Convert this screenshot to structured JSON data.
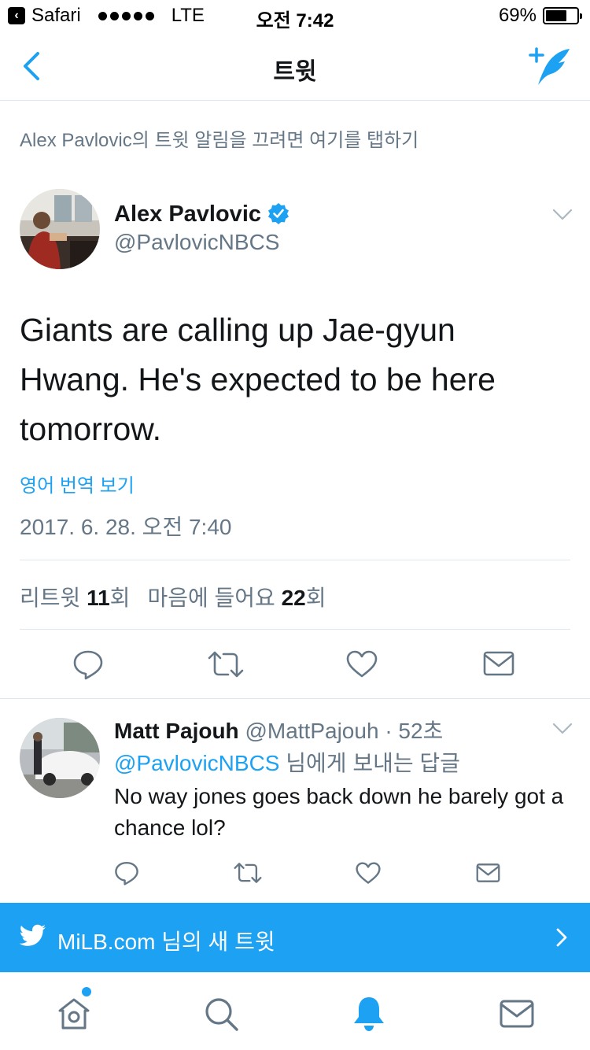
{
  "status_bar": {
    "back_app": "Safari",
    "carrier": "LTE",
    "time": "오전 7:42",
    "battery": "69%",
    "battery_level": 0.69
  },
  "nav": {
    "title": "트윗",
    "back_icon": "chevron-left-icon",
    "compose_icon": "compose-tweet-icon"
  },
  "notification_prompt": "Alex Pavlovic의 트윗 알림을 끄려면 여기를 탭하기",
  "tweet": {
    "author_name": "Alex Pavlovic",
    "author_handle": "@PavlovicNBCS",
    "verified": true,
    "text": "Giants are calling up Jae-gyun Hwang. He's expected to be here tomorrow.",
    "translate_link": "영어 번역 보기",
    "timestamp": "2017. 6. 28. 오전 7:40",
    "stats": {
      "retweets_label": "리트윗",
      "retweets_count": "11",
      "retweets_unit": "회",
      "likes_label": "마음에 들어요",
      "likes_count": "22",
      "likes_unit": "회"
    }
  },
  "reply": {
    "author_name": "Matt Pajouh",
    "author_handle": "@MattPajouh",
    "time": "· 52초",
    "replying_to_mention": "@PavlovicNBCS",
    "replying_to_suffix": " 님에게 보내는 답글",
    "text": "No way jones goes back down he barely got a chance lol?"
  },
  "banner": {
    "text": "MiLB.com 님의 새 트윗"
  },
  "tabs": [
    {
      "name": "home",
      "icon": "home-icon",
      "has_badge": true
    },
    {
      "name": "search",
      "icon": "search-icon"
    },
    {
      "name": "notifications",
      "icon": "bell-icon",
      "active": true
    },
    {
      "name": "messages",
      "icon": "mail-icon"
    }
  ],
  "colors": {
    "accent": "#1da1f2",
    "text": "#14171a",
    "secondary": "#657786",
    "divider": "#e1e8ed"
  }
}
